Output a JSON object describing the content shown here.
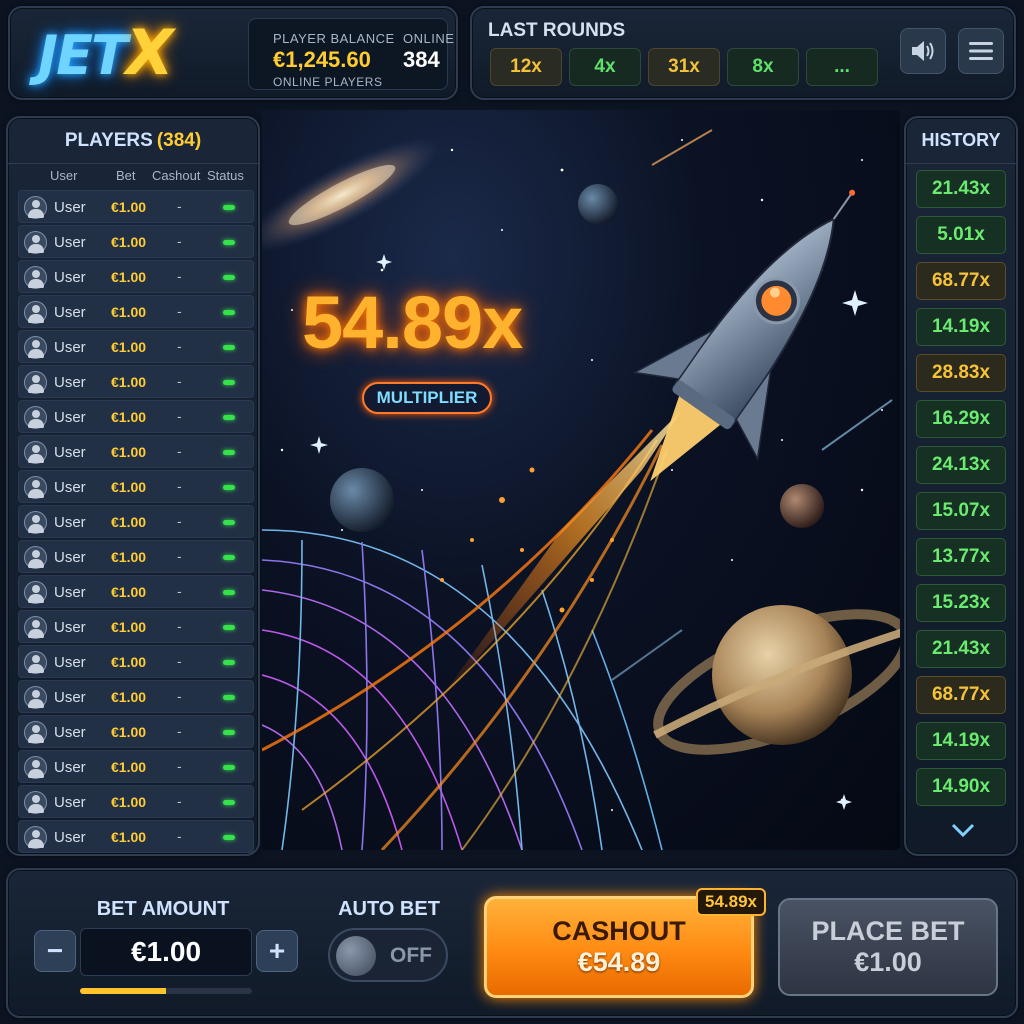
{
  "brand": {
    "logo_jet": "JET",
    "logo_x": "X"
  },
  "header": {
    "balance_label": "PLAYER BALANCE",
    "balance_value": "€1,245.60",
    "online_label": "ONLINE",
    "online_value": "384",
    "online_players_label": "ONLINE PLAYERS"
  },
  "last_rounds": {
    "title": "LAST ROUNDS",
    "chips": [
      {
        "label": "12x",
        "color": "gold"
      },
      {
        "label": "4x",
        "color": "green"
      },
      {
        "label": "31x",
        "color": "gold"
      },
      {
        "label": "8x",
        "color": "green"
      },
      {
        "label": "...",
        "color": "green"
      }
    ]
  },
  "icons": {
    "sound": "speaker-icon",
    "menu": "hamburger-menu-icon"
  },
  "players": {
    "title": "PLAYERS",
    "count": "(384)",
    "columns": [
      "User",
      "Bet",
      "Cashout",
      "Status"
    ],
    "rows": [
      {
        "user": "User",
        "bet": "€1.00",
        "cashout": "-"
      },
      {
        "user": "User",
        "bet": "€1.00",
        "cashout": "-"
      },
      {
        "user": "User",
        "bet": "€1.00",
        "cashout": "-"
      },
      {
        "user": "User",
        "bet": "€1.00",
        "cashout": "-"
      },
      {
        "user": "User",
        "bet": "€1.00",
        "cashout": "-"
      },
      {
        "user": "User",
        "bet": "€1.00",
        "cashout": "-"
      },
      {
        "user": "User",
        "bet": "€1.00",
        "cashout": "-"
      },
      {
        "user": "User",
        "bet": "€1.00",
        "cashout": "-"
      },
      {
        "user": "User",
        "bet": "€1.00",
        "cashout": "-"
      },
      {
        "user": "User",
        "bet": "€1.00",
        "cashout": "-"
      },
      {
        "user": "User",
        "bet": "€1.00",
        "cashout": "-"
      },
      {
        "user": "User",
        "bet": "€1.00",
        "cashout": "-"
      },
      {
        "user": "User",
        "bet": "€1.00",
        "cashout": "-"
      },
      {
        "user": "User",
        "bet": "€1.00",
        "cashout": "-"
      },
      {
        "user": "User",
        "bet": "€1.00",
        "cashout": "-"
      },
      {
        "user": "User",
        "bet": "€1.00",
        "cashout": "-"
      },
      {
        "user": "User",
        "bet": "€1.00",
        "cashout": "-"
      },
      {
        "user": "User",
        "bet": "€1.00",
        "cashout": "-"
      },
      {
        "user": "User",
        "bet": "€1.00",
        "cashout": "-"
      }
    ]
  },
  "game": {
    "multiplier": "54.89x",
    "multiplier_label": "MULTIPLIER"
  },
  "history": {
    "title": "HISTORY",
    "items": [
      {
        "label": "21.43x",
        "color": "green"
      },
      {
        "label": "5.01x",
        "color": "green"
      },
      {
        "label": "68.77x",
        "color": "gold"
      },
      {
        "label": "14.19x",
        "color": "green"
      },
      {
        "label": "28.83x",
        "color": "gold"
      },
      {
        "label": "16.29x",
        "color": "green"
      },
      {
        "label": "24.13x",
        "color": "green"
      },
      {
        "label": "15.07x",
        "color": "green"
      },
      {
        "label": "13.77x",
        "color": "green"
      },
      {
        "label": "15.23x",
        "color": "green"
      },
      {
        "label": "21.43x",
        "color": "green"
      },
      {
        "label": "68.77x",
        "color": "gold"
      },
      {
        "label": "14.19x",
        "color": "green"
      },
      {
        "label": "14.90x",
        "color": "green"
      }
    ]
  },
  "bet": {
    "label": "BET AMOUNT",
    "minus": "−",
    "plus": "+",
    "value": "€1.00",
    "progress": 0.5
  },
  "auto_bet": {
    "label": "AUTO BET",
    "state": "OFF"
  },
  "cashout": {
    "line1": "CASHOUT",
    "line2": "€54.89",
    "badge": "54.89x"
  },
  "place_bet": {
    "line1": "PLACE BET",
    "line2": "€1.00"
  },
  "colors": {
    "gold": "#ffcc33",
    "green": "#5fe06a",
    "accent_orange": "#ff8a12",
    "logo_blue": "#6fd4ff"
  }
}
